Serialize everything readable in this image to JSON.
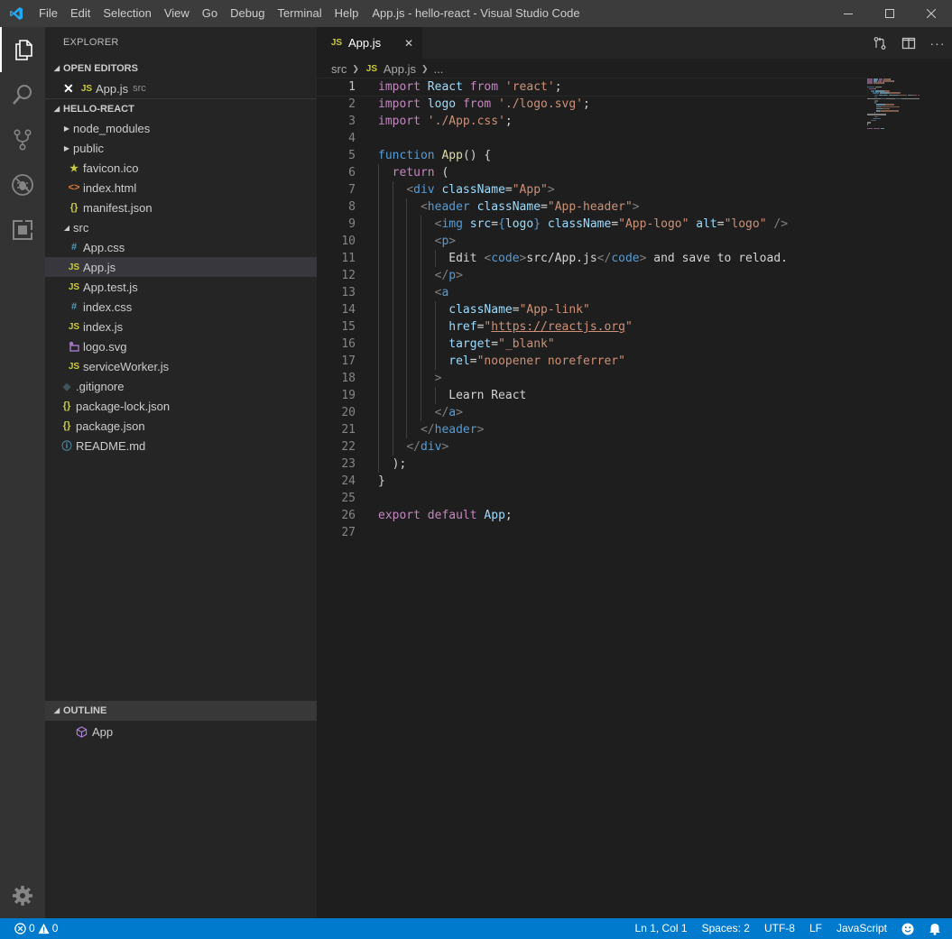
{
  "window": {
    "title": "App.js - hello-react - Visual Studio Code",
    "menu": [
      "File",
      "Edit",
      "Selection",
      "View",
      "Go",
      "Debug",
      "Terminal",
      "Help"
    ]
  },
  "sidebar": {
    "title": "EXPLORER",
    "open_editors": {
      "header": "OPEN EDITORS",
      "items": [
        {
          "badge": "JS",
          "name": "App.js",
          "desc": "src"
        }
      ]
    },
    "project": {
      "header": "HELLO-REACT",
      "tree": {
        "node_modules": "node_modules",
        "public": "public",
        "favicon": "favicon.ico",
        "index_html": "index.html",
        "manifest": "manifest.json",
        "src": "src",
        "app_css": "App.css",
        "app_js": "App.js",
        "app_test": "App.test.js",
        "index_css": "index.css",
        "index_js": "index.js",
        "logo_svg": "logo.svg",
        "service_worker": "serviceWorker.js",
        "gitignore": ".gitignore",
        "package_lock": "package-lock.json",
        "package_json": "package.json",
        "readme": "README.md"
      }
    },
    "outline": {
      "header": "OUTLINE",
      "items": [
        "App"
      ]
    }
  },
  "editor": {
    "tab": {
      "badge": "JS",
      "label": "App.js"
    },
    "breadcrumb": {
      "folder": "src",
      "badge": "JS",
      "file": "App.js",
      "more": "..."
    },
    "lines": [
      [
        [
          "kw",
          "import"
        ],
        [
          "pl",
          " "
        ],
        [
          "va",
          "React"
        ],
        [
          "pl",
          " "
        ],
        [
          "kw",
          "from"
        ],
        [
          "pl",
          " "
        ],
        [
          "st",
          "'react'"
        ],
        [
          "pl",
          ";"
        ]
      ],
      [
        [
          "kw",
          "import"
        ],
        [
          "pl",
          " "
        ],
        [
          "va",
          "logo"
        ],
        [
          "pl",
          " "
        ],
        [
          "kw",
          "from"
        ],
        [
          "pl",
          " "
        ],
        [
          "st",
          "'./logo.svg'"
        ],
        [
          "pl",
          ";"
        ]
      ],
      [
        [
          "kw",
          "import"
        ],
        [
          "pl",
          " "
        ],
        [
          "st",
          "'./App.css'"
        ],
        [
          "pl",
          ";"
        ]
      ],
      [],
      [
        [
          "kb",
          "function"
        ],
        [
          "pl",
          " "
        ],
        [
          "fn",
          "App"
        ],
        [
          "pl",
          "() {"
        ]
      ],
      [
        [
          "pl",
          "  "
        ],
        [
          "kw",
          "return"
        ],
        [
          "pl",
          " ("
        ]
      ],
      [
        [
          "pl",
          "    "
        ],
        [
          "br",
          "<"
        ],
        [
          "tg",
          "div"
        ],
        [
          "pl",
          " "
        ],
        [
          "at",
          "className"
        ],
        [
          "pl",
          "="
        ],
        [
          "st",
          "\"App\""
        ],
        [
          "br",
          ">"
        ]
      ],
      [
        [
          "pl",
          "      "
        ],
        [
          "br",
          "<"
        ],
        [
          "tg",
          "header"
        ],
        [
          "pl",
          " "
        ],
        [
          "at",
          "className"
        ],
        [
          "pl",
          "="
        ],
        [
          "st",
          "\"App-header\""
        ],
        [
          "br",
          ">"
        ]
      ],
      [
        [
          "pl",
          "        "
        ],
        [
          "br",
          "<"
        ],
        [
          "tg",
          "img"
        ],
        [
          "pl",
          " "
        ],
        [
          "at",
          "src"
        ],
        [
          "pl",
          "="
        ],
        [
          "kb",
          "{"
        ],
        [
          "va",
          "logo"
        ],
        [
          "kb",
          "}"
        ],
        [
          "pl",
          " "
        ],
        [
          "at",
          "className"
        ],
        [
          "pl",
          "="
        ],
        [
          "st",
          "\"App-logo\""
        ],
        [
          "pl",
          " "
        ],
        [
          "at",
          "alt"
        ],
        [
          "pl",
          "="
        ],
        [
          "st",
          "\"logo\""
        ],
        [
          "pl",
          " "
        ],
        [
          "br",
          "/>"
        ]
      ],
      [
        [
          "pl",
          "        "
        ],
        [
          "br",
          "<"
        ],
        [
          "tg",
          "p"
        ],
        [
          "br",
          ">"
        ]
      ],
      [
        [
          "pl",
          "          Edit "
        ],
        [
          "br",
          "<"
        ],
        [
          "tg",
          "code"
        ],
        [
          "br",
          ">"
        ],
        [
          "pl",
          "src/App.js"
        ],
        [
          "br",
          "</"
        ],
        [
          "tg",
          "code"
        ],
        [
          "br",
          ">"
        ],
        [
          "pl",
          " and save to reload."
        ]
      ],
      [
        [
          "pl",
          "        "
        ],
        [
          "br",
          "</"
        ],
        [
          "tg",
          "p"
        ],
        [
          "br",
          ">"
        ]
      ],
      [
        [
          "pl",
          "        "
        ],
        [
          "br",
          "<"
        ],
        [
          "tg",
          "a"
        ]
      ],
      [
        [
          "pl",
          "          "
        ],
        [
          "at",
          "className"
        ],
        [
          "pl",
          "="
        ],
        [
          "st",
          "\"App-link\""
        ]
      ],
      [
        [
          "pl",
          "          "
        ],
        [
          "at",
          "href"
        ],
        [
          "pl",
          "="
        ],
        [
          "st",
          "\""
        ],
        [
          "stu",
          "https://reactjs.org"
        ],
        [
          "st",
          "\""
        ]
      ],
      [
        [
          "pl",
          "          "
        ],
        [
          "at",
          "target"
        ],
        [
          "pl",
          "="
        ],
        [
          "st",
          "\"_blank\""
        ]
      ],
      [
        [
          "pl",
          "          "
        ],
        [
          "at",
          "rel"
        ],
        [
          "pl",
          "="
        ],
        [
          "st",
          "\"noopener noreferrer\""
        ]
      ],
      [
        [
          "pl",
          "        "
        ],
        [
          "br",
          ">"
        ]
      ],
      [
        [
          "pl",
          "          Learn React"
        ]
      ],
      [
        [
          "pl",
          "        "
        ],
        [
          "br",
          "</"
        ],
        [
          "tg",
          "a"
        ],
        [
          "br",
          ">"
        ]
      ],
      [
        [
          "pl",
          "      "
        ],
        [
          "br",
          "</"
        ],
        [
          "tg",
          "header"
        ],
        [
          "br",
          ">"
        ]
      ],
      [
        [
          "pl",
          "    "
        ],
        [
          "br",
          "</"
        ],
        [
          "tg",
          "div"
        ],
        [
          "br",
          ">"
        ]
      ],
      [
        [
          "pl",
          "  );"
        ]
      ],
      [
        [
          "pl",
          "}"
        ]
      ],
      [],
      [
        [
          "kw",
          "export"
        ],
        [
          "pl",
          " "
        ],
        [
          "kw",
          "default"
        ],
        [
          "pl",
          " "
        ],
        [
          "va",
          "App"
        ],
        [
          "pl",
          ";"
        ]
      ],
      []
    ]
  },
  "statusbar": {
    "errors": "0",
    "warnings": "0",
    "position": "Ln 1, Col 1",
    "spaces": "Spaces: 2",
    "encoding": "UTF-8",
    "eol": "LF",
    "language": "JavaScript"
  },
  "icons": {
    "activity": [
      "files-icon",
      "search-icon",
      "source-control-icon",
      "debug-icon",
      "extensions-icon",
      "settings-gear-icon"
    ],
    "accent": "#007acc"
  }
}
